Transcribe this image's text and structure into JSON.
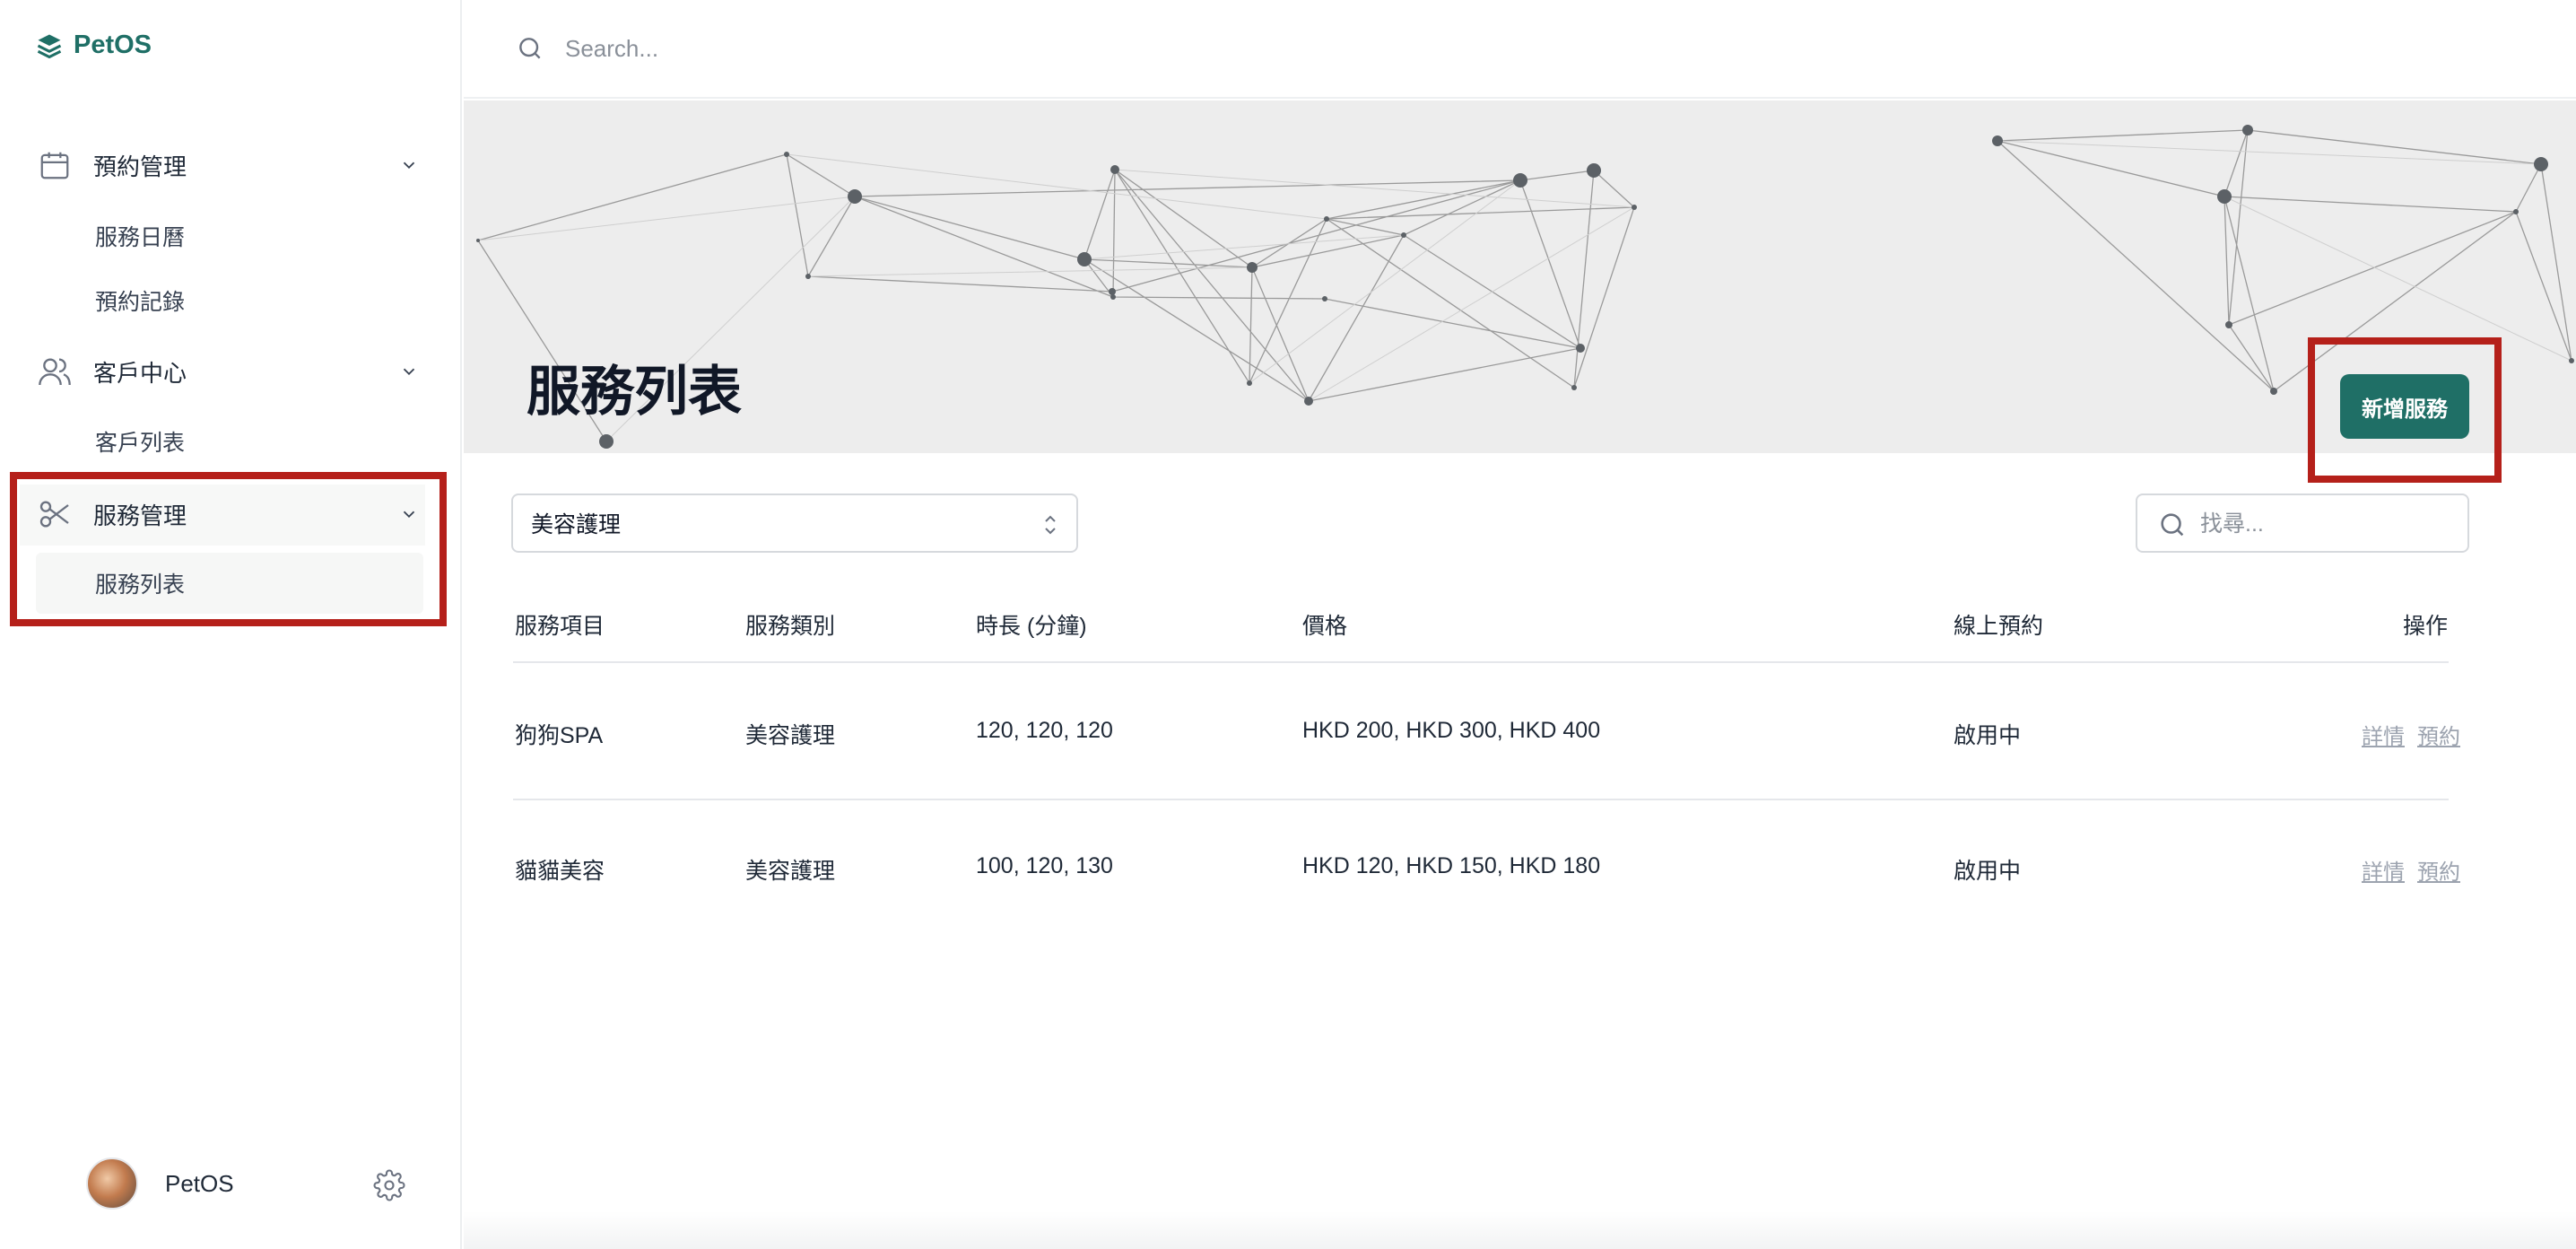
{
  "app": {
    "name": "PetOS"
  },
  "sidebar": {
    "groups": [
      {
        "label": "預約管理",
        "icon": "calendar-icon",
        "items": [
          "服務日曆",
          "預約記錄"
        ]
      },
      {
        "label": "客戶中心",
        "icon": "users-icon",
        "items": [
          "客戶列表"
        ]
      },
      {
        "label": "服務管理",
        "icon": "scissors-icon",
        "items": [
          "服務列表"
        ],
        "active": true
      }
    ],
    "profile_name": "PetOS"
  },
  "search": {
    "placeholder": "Search..."
  },
  "page": {
    "title": "服務列表",
    "add_button": "新增服務"
  },
  "filters": {
    "category_selected": "美容護理",
    "find_placeholder": "找尋..."
  },
  "table": {
    "headers": [
      "服務項目",
      "服務類別",
      "時長 (分鐘)",
      "價格",
      "線上預約",
      "操作"
    ],
    "rows": [
      {
        "name": "狗狗SPA",
        "category": "美容護理",
        "duration": "120, 120, 120",
        "price": "HKD 200, HKD 300, HKD 400",
        "online": "啟用中",
        "actions": [
          "詳情",
          "預約"
        ]
      },
      {
        "name": "貓貓美容",
        "category": "美容護理",
        "duration": "100, 120, 130",
        "price": "HKD 120, HKD 150, HKD 180",
        "online": "啟用中",
        "actions": [
          "詳情",
          "預約"
        ]
      }
    ]
  },
  "colors": {
    "brand": "#1f6f66",
    "highlight": "#b5201a"
  }
}
